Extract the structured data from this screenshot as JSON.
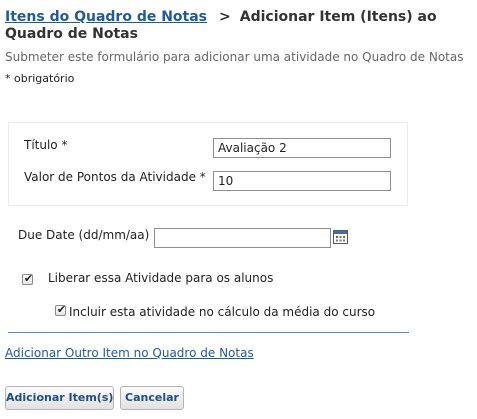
{
  "breadcrumb": {
    "parent": "Itens do Quadro de Notas",
    "separator": ">",
    "current": "Adicionar Item (Itens) ao Quadro de Notas"
  },
  "subtitle": "Submeter este formulário para adicionar uma atividade no Quadro de Notas",
  "required_note": "* obrigatório",
  "form": {
    "title_label": "Título *",
    "title_value": "Avaliação 2",
    "points_label": "Valor de Pontos da Atividade *",
    "points_value": "10",
    "due_date_label": "Due Date (dd/mm/aa)",
    "due_date_value": "",
    "release_label": "Liberar essa Atividade para os alunos",
    "release_checked": true,
    "include_label": "Incluir esta atividade no cálculo da média do curso",
    "include_checked": true,
    "checkmark": "✔"
  },
  "add_another_link": "Adicionar Outro Item no Quadro de Notas",
  "buttons": {
    "submit": "Adicionar Item(s)",
    "cancel": "Cancelar"
  },
  "colors": {
    "link": "#1d5c9f",
    "divider": "#5b8fc4",
    "calendar": "#3a6fb0"
  }
}
